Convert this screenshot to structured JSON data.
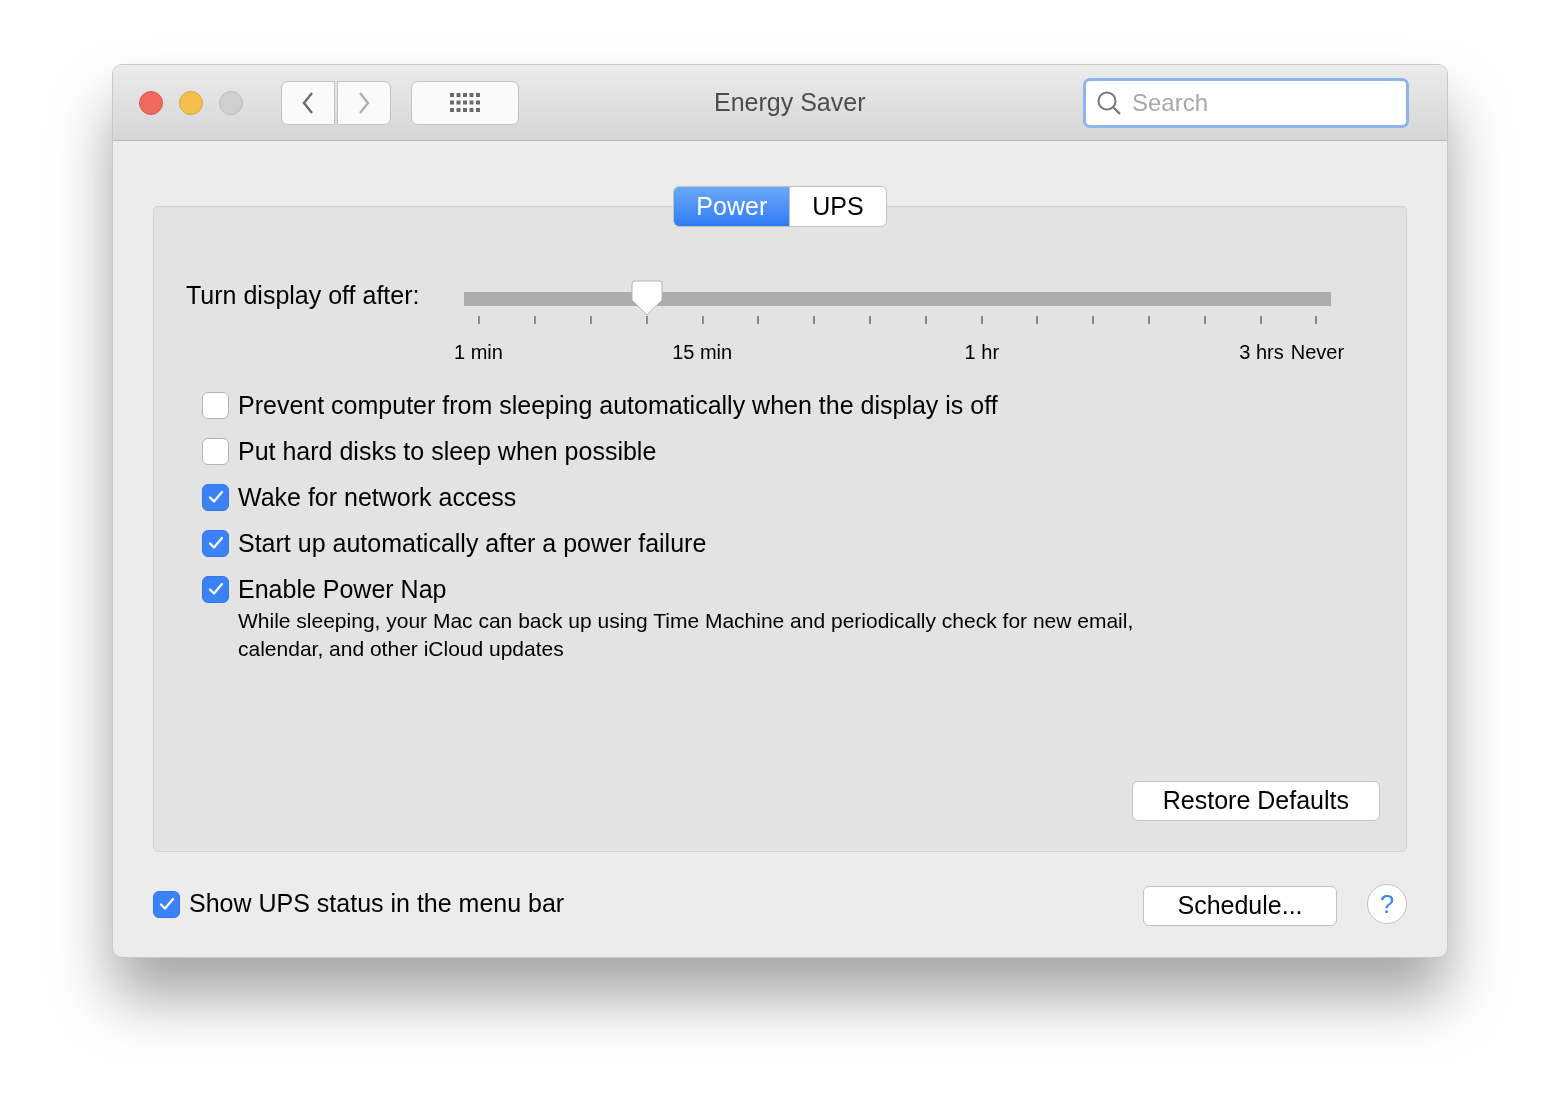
{
  "window": {
    "title": "Energy Saver"
  },
  "search": {
    "placeholder": "Search"
  },
  "tabs": [
    {
      "label": "Power",
      "selected": true
    },
    {
      "label": "UPS",
      "selected": false
    }
  ],
  "slider": {
    "label": "Turn display off after:",
    "level": 0.21,
    "tick_labels": [
      "1 min",
      "15 min",
      "1 hr",
      "3 hrs",
      "Never"
    ]
  },
  "options": [
    {
      "label": "Prevent computer from sleeping automatically when the display is off",
      "checked": false
    },
    {
      "label": "Put hard disks to sleep when possible",
      "checked": false
    },
    {
      "label": "Wake for network access",
      "checked": true
    },
    {
      "label": "Start up automatically after a power failure",
      "checked": true
    },
    {
      "label": "Enable Power Nap",
      "checked": true,
      "description": "While sleeping, your Mac can back up using Time Machine and periodically check for new email, calendar, and other iCloud updates"
    }
  ],
  "restore_button": "Restore Defaults",
  "ups_status": {
    "label": "Show UPS status in the menu bar",
    "checked": true
  },
  "schedule_button": "Schedule...",
  "help_button": "?"
}
